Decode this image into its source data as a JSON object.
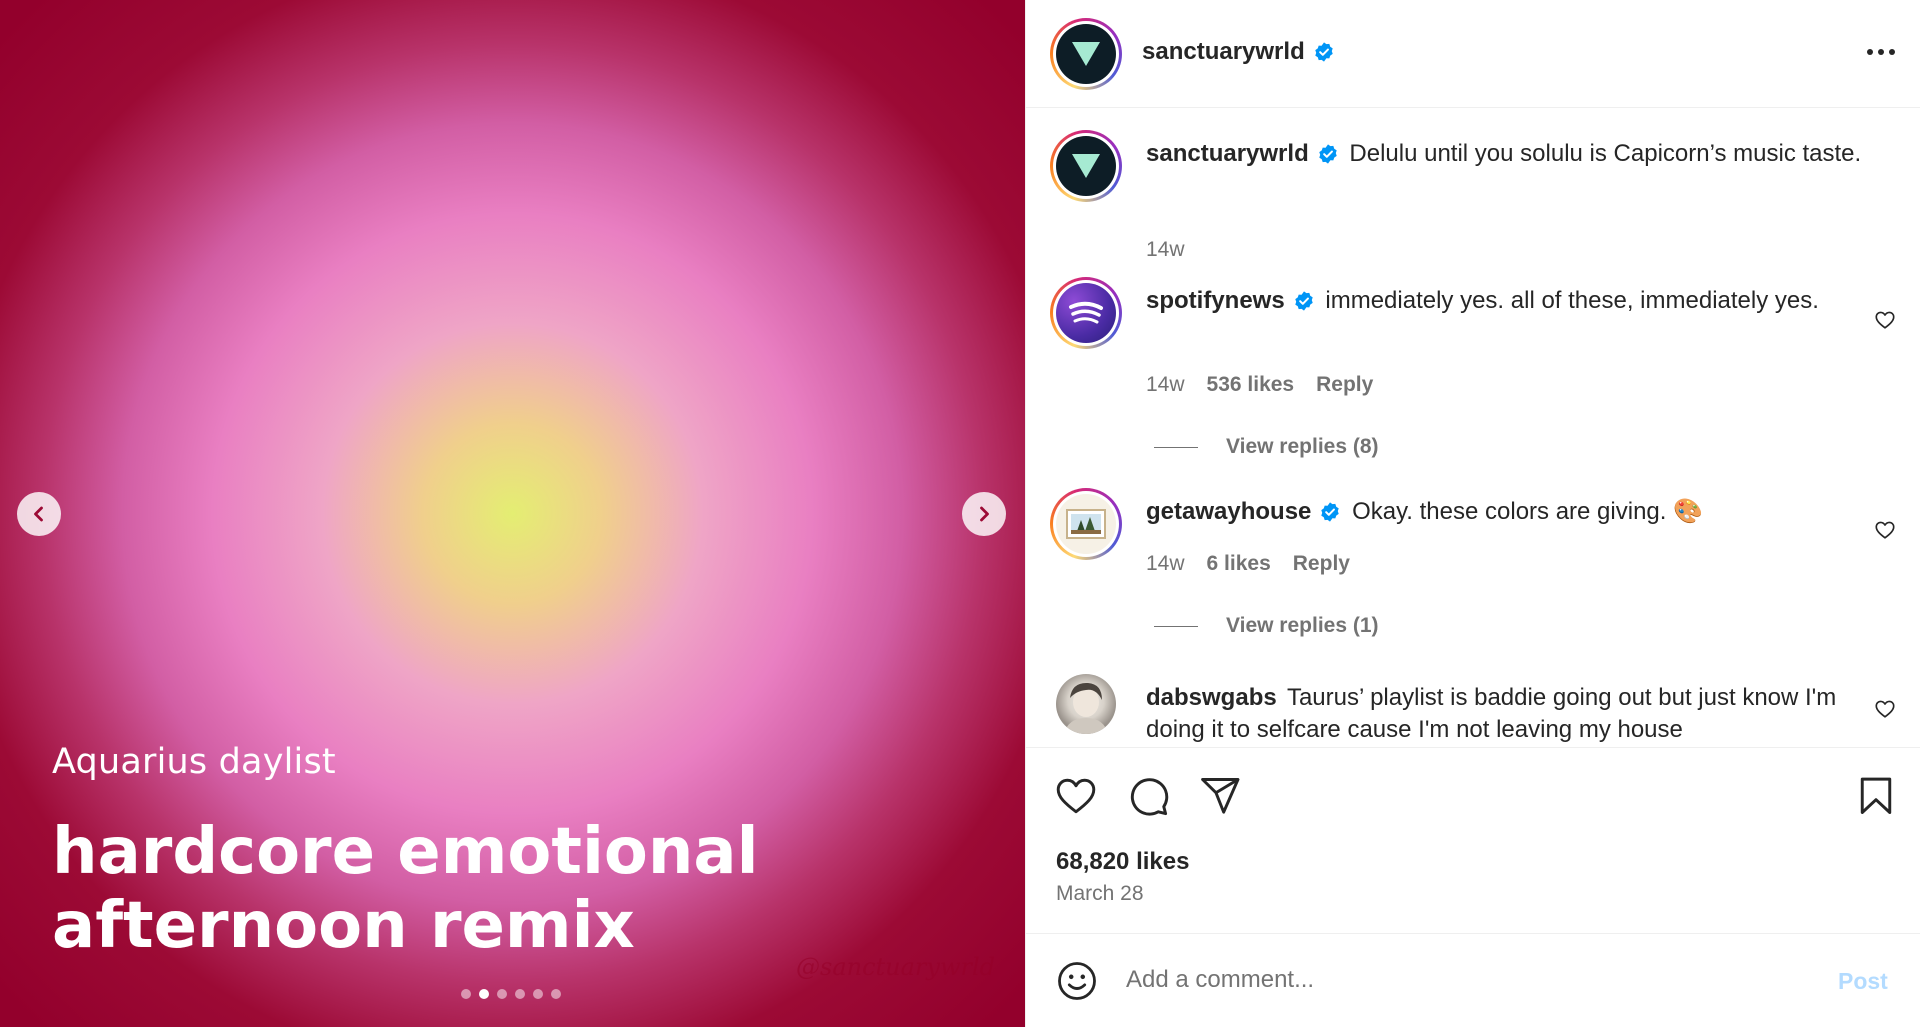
{
  "media": {
    "slide_subtitle": "Aquarius daylist",
    "slide_title": "hardcore emotional afternoon remix",
    "watermark": "@sanctuarywrld",
    "slide_count": 6,
    "active_slide": 2,
    "prev_icon": "chevron-left-icon",
    "next_icon": "chevron-right-icon"
  },
  "header": {
    "username": "sanctuarywrld",
    "verified": true,
    "more_icon": "more-horizontal-icon"
  },
  "caption": {
    "username": "sanctuarywrld",
    "text": "Delulu until you solulu is Capicorn’s music taste.",
    "time": "14w"
  },
  "comments": [
    {
      "username": "spotifynews",
      "text": "immediately yes. all of these, immediately yes.",
      "time": "14w",
      "likes": "536 likes",
      "reply": "Reply",
      "view_replies": "View replies (8)"
    },
    {
      "username": "getawayhouse",
      "text": "Okay. these colors are giving. 🎨",
      "time": "14w",
      "likes": "6 likes",
      "reply": "Reply",
      "view_replies": "View replies (1)"
    },
    {
      "username": "dabswgabs",
      "text": "Taurus’ playlist is baddie going out but just know I'm doing it to selfcare cause I'm not leaving my house"
    }
  ],
  "actions": {
    "likes": "68,820 likes",
    "date": "March 28"
  },
  "composer": {
    "placeholder": "Add a comment...",
    "post_label": "Post"
  },
  "colors": {
    "verified_blue": "#0095f6",
    "post_button_disabled": "#b3dbff",
    "media_background": "#93002c"
  }
}
